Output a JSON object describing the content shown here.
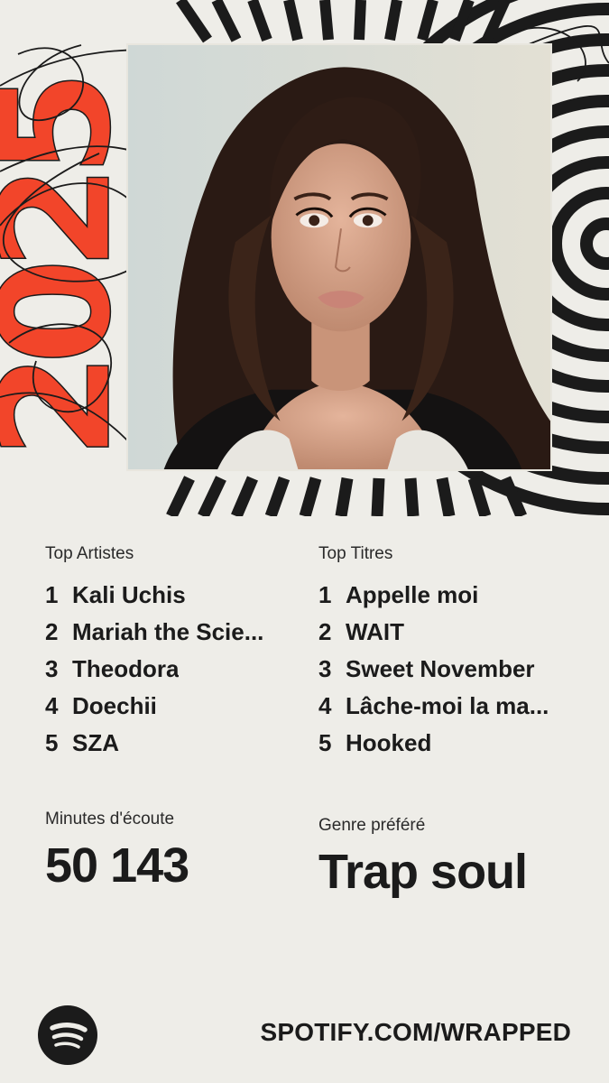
{
  "year_graphic": "2025",
  "colors": {
    "accent": "#f2452a",
    "ink": "#1b1b1b",
    "background": "#eeede8"
  },
  "top_artists": {
    "label": "Top Artistes",
    "items": [
      {
        "rank": "1",
        "name": "Kali Uchis"
      },
      {
        "rank": "2",
        "name": "Mariah the Scie..."
      },
      {
        "rank": "3",
        "name": "Theodora"
      },
      {
        "rank": "4",
        "name": "Doechii"
      },
      {
        "rank": "5",
        "name": "SZA"
      }
    ]
  },
  "top_tracks": {
    "label": "Top Titres",
    "items": [
      {
        "rank": "1",
        "name": "Appelle moi"
      },
      {
        "rank": "2",
        "name": "WAIT"
      },
      {
        "rank": "3",
        "name": "Sweet November"
      },
      {
        "rank": "4",
        "name": "Lâche-moi la ma..."
      },
      {
        "rank": "5",
        "name": "Hooked"
      }
    ]
  },
  "minutes": {
    "label": "Minutes d'écoute",
    "value": "50 143"
  },
  "genre": {
    "label": "Genre préféré",
    "value": "Trap soul"
  },
  "footer": {
    "logo_icon": "spotify-icon",
    "url": "SPOTIFY.COM/WRAPPED"
  }
}
